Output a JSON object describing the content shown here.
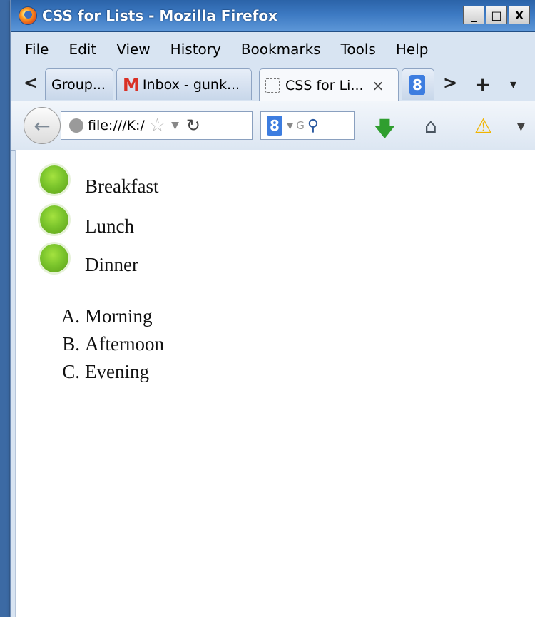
{
  "window": {
    "title": "CSS for Lists - Mozilla Firefox",
    "min_label": "_",
    "max_label": "□",
    "close_label": "X"
  },
  "menu": [
    "File",
    "Edit",
    "View",
    "History",
    "Bookmarks",
    "Tools",
    "Help"
  ],
  "tabs": [
    {
      "label": "Group..."
    },
    {
      "label": "Inbox - gunk..."
    },
    {
      "label": "CSS for Li..."
    }
  ],
  "tabbar": {
    "scroll_left": "<",
    "scroll_right": ">",
    "new_tab": "+",
    "all_tabs": "▾",
    "close": "×",
    "g8": "8",
    "gmail_m": "M"
  },
  "nav": {
    "url": "file:///K:/",
    "search_g": "8",
    "search_G": "G"
  },
  "page": {
    "bullet_items": [
      "Breakfast",
      "Lunch",
      "Dinner"
    ],
    "ordered_items": [
      {
        "marker": "A.",
        "text": "Morning"
      },
      {
        "marker": "B.",
        "text": "Afternoon"
      },
      {
        "marker": "C.",
        "text": "Evening"
      }
    ]
  },
  "icons": {
    "bullet_color": "#7bc52c",
    "download_color": "#2f9e2f",
    "warning_color": "#f0b400"
  }
}
